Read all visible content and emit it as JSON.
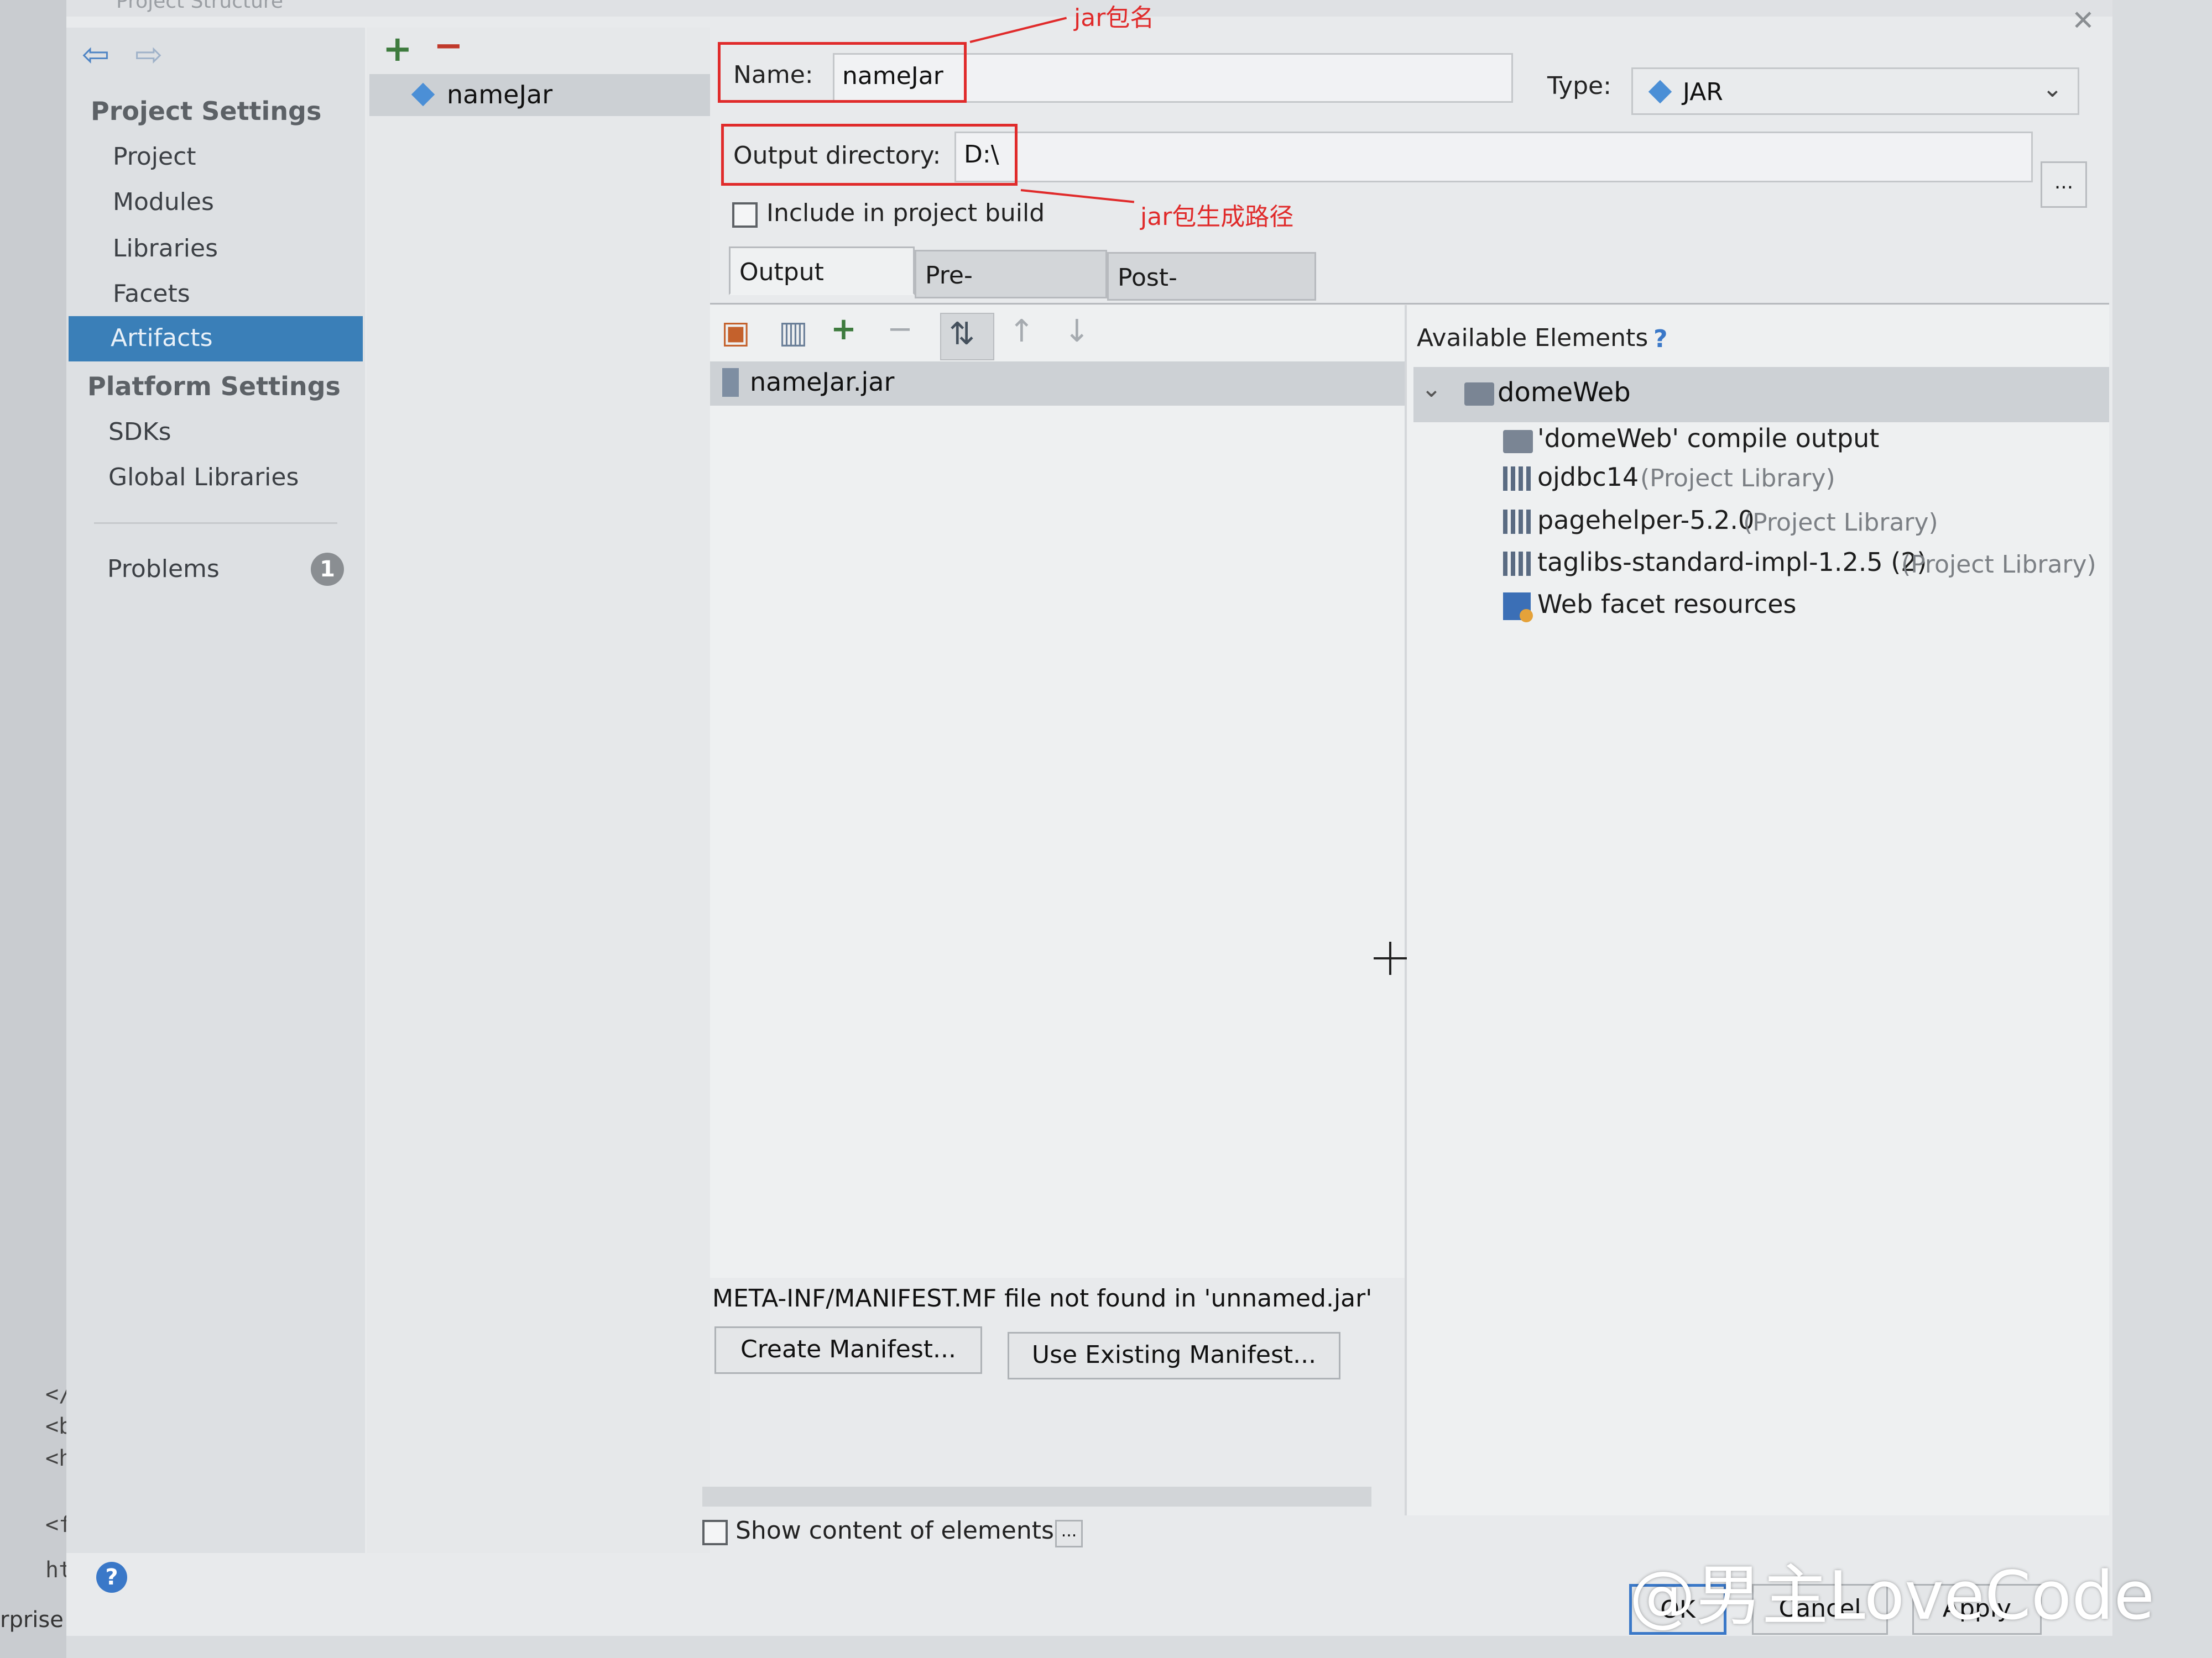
{
  "window": {
    "title": "Project Structure",
    "close_icon": "close-icon"
  },
  "nav": {
    "back_icon": "arrow-left-icon",
    "forward_icon": "arrow-right-icon",
    "project_settings_header": "Project Settings",
    "project_settings_items": [
      "Project",
      "Modules",
      "Libraries",
      "Facets",
      "Artifacts"
    ],
    "selected_item": "Artifacts",
    "platform_settings_header": "Platform Settings",
    "platform_settings_items": [
      "SDKs",
      "Global Libraries"
    ],
    "problems_label": "Problems",
    "problems_count": "1"
  },
  "artifacts": {
    "add_label": "+",
    "remove_label": "−",
    "items": [
      "nameJar"
    ]
  },
  "form": {
    "name_label": "Name:",
    "name_value": "nameJar",
    "type_label": "Type:",
    "type_value": "JAR",
    "output_dir_label": "Output directory:",
    "output_dir_value": "D:\\",
    "browse_label": "...",
    "include_build_label": "Include in project build",
    "include_build_checked": false
  },
  "annotations": {
    "jar_name_note": "jar包名",
    "jar_path_note": "jar包生成路径",
    "color": "#e02b2b"
  },
  "tabs": [
    "Output Layout",
    "Pre-processing",
    "Post-processing"
  ],
  "active_tab": "Output Layout",
  "layout": {
    "toolbar_icons": [
      "new-folder-icon",
      "archive-icon",
      "add-icon",
      "remove-icon",
      "sort-icon",
      "move-up-icon",
      "move-down-icon"
    ],
    "items": [
      "nameJar.jar"
    ]
  },
  "available": {
    "header": "Available Elements",
    "help_label": "?",
    "root": "domeWeb",
    "children": [
      {
        "name": "'domeWeb' compile output",
        "note": "",
        "icon": "folder-icon"
      },
      {
        "name": "ojdbc14",
        "note": "(Project Library)",
        "icon": "library-icon"
      },
      {
        "name": "pagehelper-5.2.0",
        "note": "(Project Library)",
        "icon": "library-icon"
      },
      {
        "name": "taglibs-standard-impl-1.2.5 (2)",
        "note": "(Project Library)",
        "icon": "library-icon"
      },
      {
        "name": "Web facet resources",
        "note": "",
        "icon": "web-facet-icon"
      }
    ]
  },
  "manifest": {
    "message": "META-INF/MANIFEST.MF file not found in 'unnamed.jar'",
    "create_button": "Create Manifest...",
    "use_existing_button": "Use Existing Manifest..."
  },
  "show_content": {
    "label": "Show content of elements",
    "checked": false,
    "more_label": "..."
  },
  "buttons": {
    "ok": "OK",
    "cancel": "Cancel",
    "apply": "Apply"
  },
  "watermark": "@男主LoveCode",
  "background_editor": {
    "code_lines": [
      "</",
      "<b",
      "<h",
      "<f",
      "ht"
    ],
    "status_text": "rprise"
  }
}
